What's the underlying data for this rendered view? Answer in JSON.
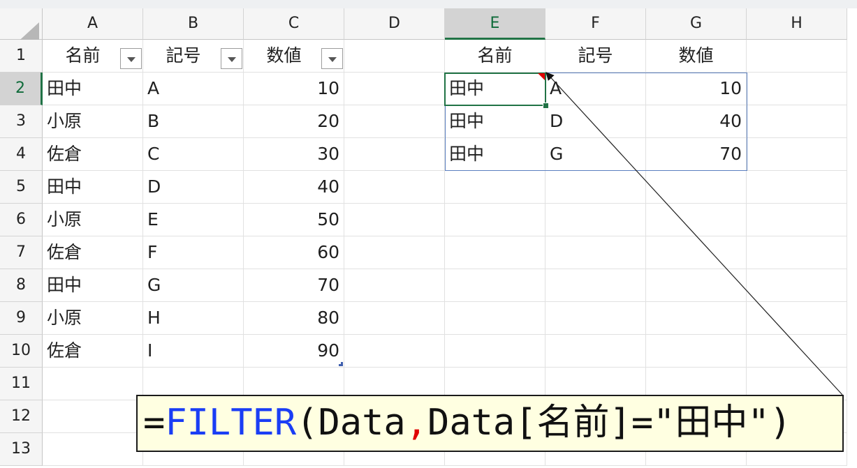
{
  "columns": [
    "A",
    "B",
    "C",
    "D",
    "E",
    "F",
    "G",
    "H"
  ],
  "selected_column": "E",
  "rows": [
    "1",
    "2",
    "3",
    "4",
    "5",
    "6",
    "7",
    "8",
    "9",
    "10",
    "11",
    "12",
    "13"
  ],
  "selected_row": "2",
  "source_table": {
    "headers": [
      "名前",
      "記号",
      "数値"
    ],
    "rows": [
      [
        "田中",
        "A",
        "10"
      ],
      [
        "小原",
        "B",
        "20"
      ],
      [
        "佐倉",
        "C",
        "30"
      ],
      [
        "田中",
        "D",
        "40"
      ],
      [
        "小原",
        "E",
        "50"
      ],
      [
        "佐倉",
        "F",
        "60"
      ],
      [
        "田中",
        "G",
        "70"
      ],
      [
        "小原",
        "H",
        "80"
      ],
      [
        "佐倉",
        "I",
        "90"
      ]
    ]
  },
  "result_table": {
    "headers": [
      "名前",
      "記号",
      "数値"
    ],
    "rows": [
      [
        "田中",
        "A",
        "10"
      ],
      [
        "田中",
        "D",
        "40"
      ],
      [
        "田中",
        "G",
        "70"
      ]
    ]
  },
  "formula": {
    "eq": "=",
    "fn": "FILTER",
    "arg1": "(Data",
    "comma": ",",
    "arg2": "Data[名前]=\"田中\")"
  },
  "colors": {
    "active_border": "#217346",
    "spill_border": "#5b7fbf",
    "callout_bg": "#ffffe1",
    "function_text": "#1a3df5",
    "comma_text": "#e00000"
  }
}
